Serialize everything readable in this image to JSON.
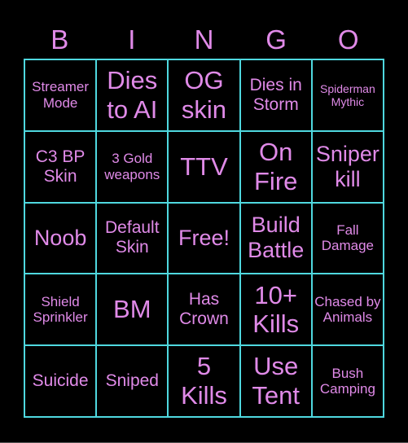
{
  "header": [
    "B",
    "I",
    "N",
    "G",
    "O"
  ],
  "colors": {
    "text": "#e08ae8",
    "grid": "#4fd8df",
    "background": "#000000"
  },
  "cells": [
    {
      "text": "Streamer Mode",
      "size": "sm"
    },
    {
      "text": "Dies to AI",
      "size": "xl"
    },
    {
      "text": "OG skin",
      "size": "xl"
    },
    {
      "text": "Dies in Storm",
      "size": "md"
    },
    {
      "text": "Spiderman Mythic",
      "size": "xs"
    },
    {
      "text": "C3 BP Skin",
      "size": "md"
    },
    {
      "text": "3 Gold weapons",
      "size": "sm"
    },
    {
      "text": "TTV",
      "size": "xl"
    },
    {
      "text": "On Fire",
      "size": "xl"
    },
    {
      "text": "Sniper kill",
      "size": "lg"
    },
    {
      "text": "Noob",
      "size": "lg"
    },
    {
      "text": "Default Skin",
      "size": "md"
    },
    {
      "text": "Free!",
      "size": "lg"
    },
    {
      "text": "Build Battle",
      "size": "lg"
    },
    {
      "text": "Fall Damage",
      "size": "sm"
    },
    {
      "text": "Shield Sprinkler",
      "size": "sm"
    },
    {
      "text": "BM",
      "size": "xl"
    },
    {
      "text": "Has Crown",
      "size": "md"
    },
    {
      "text": "10+ Kills",
      "size": "xl"
    },
    {
      "text": "Chased by Animals",
      "size": "sm"
    },
    {
      "text": "Suicide",
      "size": "md"
    },
    {
      "text": "Sniped",
      "size": "md"
    },
    {
      "text": "5 Kills",
      "size": "xl"
    },
    {
      "text": "Use Tent",
      "size": "xl"
    },
    {
      "text": "Bush Camping",
      "size": "sm"
    }
  ]
}
